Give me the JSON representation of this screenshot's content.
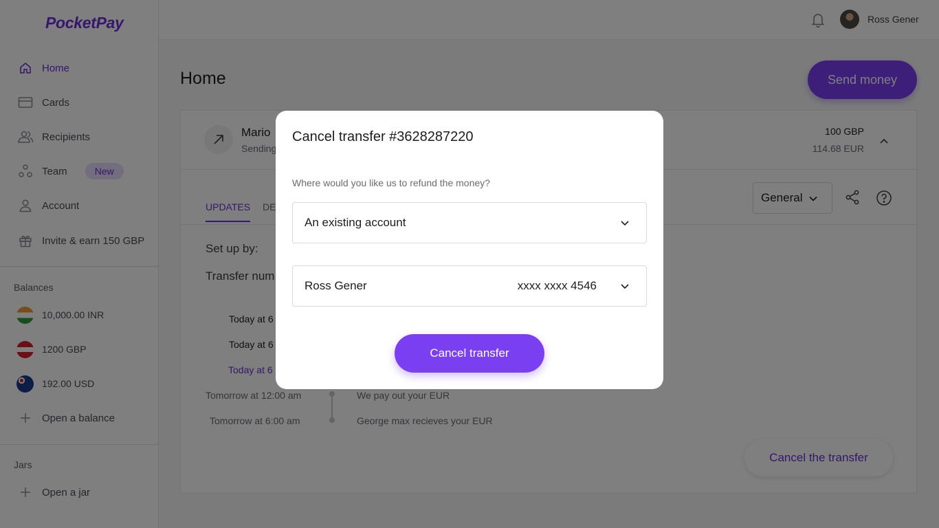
{
  "app": {
    "logo": "PocketPay"
  },
  "sidebar": {
    "nav": [
      {
        "label": "Home",
        "icon": "home-icon",
        "active": true
      },
      {
        "label": "Cards",
        "icon": "card-icon"
      },
      {
        "label": "Recipients",
        "icon": "recipients-icon"
      },
      {
        "label": "Team",
        "icon": "team-icon",
        "badge": "New"
      },
      {
        "label": "Account",
        "icon": "account-icon"
      },
      {
        "label": "Invite & earn 150 GBP",
        "icon": "gift-icon"
      }
    ],
    "balances_label": "Balances",
    "balances": [
      {
        "label": "10,000.00 INR",
        "flag": "india-flag-icon"
      },
      {
        "label": "1200 GBP",
        "flag": "uk-flag-icon"
      },
      {
        "label": "192.00 USD",
        "flag": "australia-flag-icon"
      }
    ],
    "open_balance": "Open a balance",
    "jars_label": "Jars",
    "open_jar": "Open a jar"
  },
  "topbar": {
    "user_name": "Ross Gener"
  },
  "main": {
    "title": "Home",
    "send_button": "Send money",
    "transfer": {
      "name": "Mario",
      "status": "Sending",
      "amount_main": "100 GBP",
      "amount_sub": "114.68 EUR",
      "tabs": [
        "UPDATES",
        "DET"
      ],
      "view_select": "General",
      "setup_by_label": "Set up by:",
      "transfer_number_label": "Transfer num",
      "timeline": [
        {
          "time": "Today at 6"
        },
        {
          "time": "Today at 6"
        },
        {
          "time": "Today at 6"
        },
        {
          "time": "Tomorrow at 12:00 am",
          "event": "We pay out your EUR"
        },
        {
          "time": "Tomorrow at 6:00 am",
          "event": "George max recieves your EUR"
        }
      ],
      "cancel_link": "Cancel the transfer"
    }
  },
  "modal": {
    "title": "Cancel transfer #3628287220",
    "question": "Where would you like us to refund the money?",
    "refund_option": "An existing account",
    "account_name": "Ross Gener",
    "account_number": "xxxx xxxx 4546",
    "cancel_button": "Cancel transfer"
  },
  "colors": {
    "brand": "#7b3ff2",
    "brand_text": "#6a2fd6"
  }
}
